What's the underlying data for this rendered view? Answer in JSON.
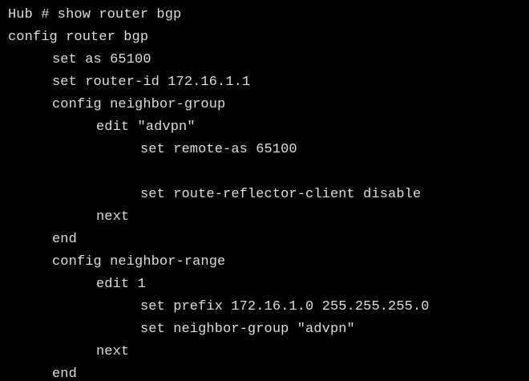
{
  "terminal": {
    "lines": [
      "Hub # show router bgp",
      "config router bgp",
      "set as 65100",
      "set router-id 172.16.1.1",
      "config neighbor-group",
      "edit \"advpn\"",
      "set remote-as 65100",
      "",
      "set route-reflector-client disable",
      "next",
      "end",
      "config neighbor-range",
      "edit 1",
      "set prefix 172.16.1.0 255.255.255.0",
      "set neighbor-group \"advpn\"",
      "next",
      "end"
    ]
  },
  "colors": {
    "background": "#000000",
    "text": "#dcdcdc"
  }
}
